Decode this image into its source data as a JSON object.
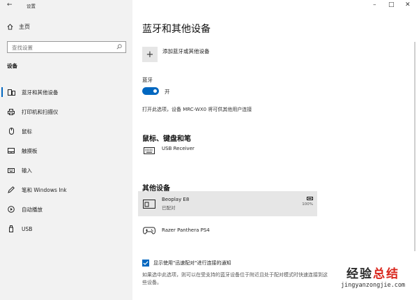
{
  "window": {
    "title": "设置",
    "back": "←",
    "minimize": "–",
    "maximize": "□",
    "close": "✕"
  },
  "sidebar": {
    "home_label": "主页",
    "search_placeholder": "查找设置",
    "section": "设备",
    "items": [
      {
        "label": "蓝牙和其他设备",
        "icon": "bluetooth-devices-icon",
        "active": true
      },
      {
        "label": "打印机和扫描仪",
        "icon": "printer-icon",
        "active": false
      },
      {
        "label": "鼠标",
        "icon": "mouse-icon",
        "active": false
      },
      {
        "label": "触摸板",
        "icon": "touchpad-icon",
        "active": false
      },
      {
        "label": "输入",
        "icon": "keyboard-icon",
        "active": false
      },
      {
        "label": "笔和 Windows Ink",
        "icon": "pen-icon",
        "active": false
      },
      {
        "label": "自动播放",
        "icon": "autoplay-icon",
        "active": false
      },
      {
        "label": "USB",
        "icon": "usb-icon",
        "active": false
      }
    ]
  },
  "main": {
    "title": "蓝牙和其他设备",
    "add_label": "添加蓝牙或其他设备",
    "add_symbol": "+",
    "bluetooth_label": "蓝牙",
    "bluetooth_state": "开",
    "discoverable_text": "打开此选项，设备 MRC-WX0 将可供其他用户连接",
    "mouse_section": "鼠标、键盘和笔",
    "usb_device": "USB Receiver",
    "other_section": "其他设备",
    "devices": [
      {
        "name": "Beoplay E8",
        "status": "已配对",
        "battery": "100%"
      },
      {
        "name": "Razer Panthera PS4",
        "status": "",
        "battery": ""
      }
    ],
    "swift_pair_label": "显示使用\"迅速配对\"进行连接的通知",
    "swift_pair_desc": "如果选中此选项，则可以在受支持的蓝牙设备位于附近且处于配对模式时快速连接到这些设备。"
  },
  "watermark": {
    "big_prefix": "经验",
    "big_accent": "总结",
    "small": "jingyanzongjie.com"
  },
  "colors": {
    "accent": "#0067c0",
    "sidebar_bg": "#f2f2f2",
    "selected_row": "#e6e6e6",
    "watermark_red": "#d9261c"
  }
}
